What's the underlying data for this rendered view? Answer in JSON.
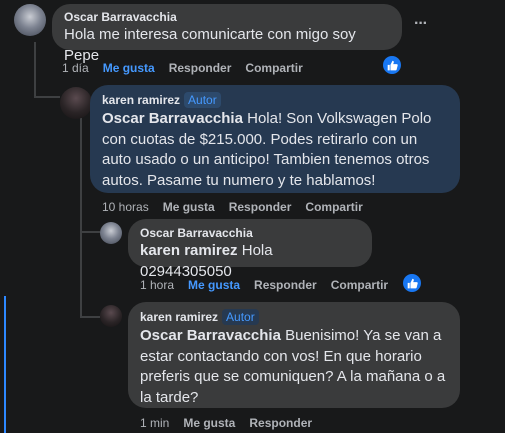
{
  "comments": [
    {
      "author": "Oscar Barravacchia",
      "text": "Hola me interesa comunicarte con migo soy Pepe",
      "time": "1 día",
      "like": "Me gusta",
      "reply": "Responder",
      "share": "Compartir",
      "liked": true,
      "more": "···"
    },
    {
      "author": "karen ramirez",
      "badge": "Autor",
      "mention": "Oscar Barravacchia",
      "text": "Hola! Son Volkswagen Polo con cuotas de $215.000. Podes retirarlo con un auto usado o un anticipo! Tambien tenemos otros autos. Pasame tu numero y te hablamos!",
      "time": "10 horas",
      "like": "Me gusta",
      "reply": "Responder",
      "share": "Compartir"
    },
    {
      "author": "Oscar Barravacchia",
      "mention": "karen ramirez",
      "text": "Hola 02944305050",
      "time": "1 hora",
      "like": "Me gusta",
      "reply": "Responder",
      "share": "Compartir",
      "liked": true
    },
    {
      "author": "karen ramirez",
      "badge": "Autor",
      "mention": "Oscar Barravacchia",
      "text": "Buenisimo! Ya se van a estar contactando con vos! En que horario preferis que se comuniquen? A la mañana o a la tarde?",
      "time": "1 min",
      "like": "Me gusta",
      "reply": "Responder"
    }
  ],
  "colors": {
    "accent": "#4599ff",
    "bubble": "#3a3b3c",
    "highlight_bubble": "#263951",
    "like_badge": "#1877f2"
  },
  "icons": {
    "like_badge": "thumbs-up-icon",
    "more": "more-options-icon"
  }
}
